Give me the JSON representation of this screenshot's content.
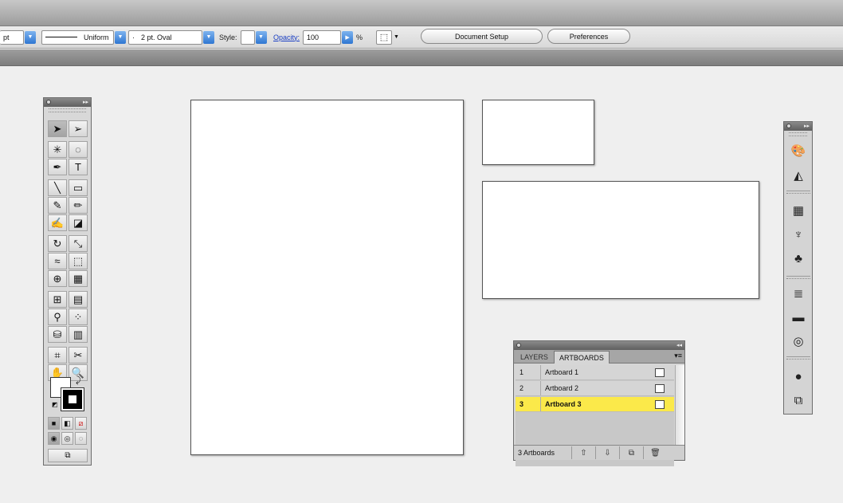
{
  "controlbar": {
    "units_value": "pt",
    "stroke_profile_label": "Uniform",
    "brush_value": "2 pt. Oval",
    "brush_prefix": "·",
    "style_label": "Style:",
    "opacity_label": "Opacity:",
    "opacity_value": "100",
    "percent_sign": "%",
    "document_setup_label": "Document Setup",
    "preferences_label": "Preferences"
  },
  "tools": [
    {
      "name": "selection-tool-icon",
      "glyph": "➤"
    },
    {
      "name": "direct-selection-tool-icon",
      "glyph": "➢"
    },
    {
      "name": "magic-wand-tool-icon",
      "glyph": "✳"
    },
    {
      "name": "lasso-tool-icon",
      "glyph": "◌"
    },
    {
      "name": "pen-tool-icon",
      "glyph": "✒"
    },
    {
      "name": "type-tool-icon",
      "glyph": "T"
    },
    {
      "name": "line-tool-icon",
      "glyph": "╲"
    },
    {
      "name": "rectangle-tool-icon",
      "glyph": "▭"
    },
    {
      "name": "paintbrush-tool-icon",
      "glyph": "✎"
    },
    {
      "name": "pencil-tool-icon",
      "glyph": "✏"
    },
    {
      "name": "blob-brush-tool-icon",
      "glyph": "✍"
    },
    {
      "name": "eraser-tool-icon",
      "glyph": "◪"
    },
    {
      "name": "rotate-tool-icon",
      "glyph": "↻"
    },
    {
      "name": "scale-tool-icon",
      "glyph": "⤡"
    },
    {
      "name": "warp-tool-icon",
      "glyph": "≈"
    },
    {
      "name": "free-transform-tool-icon",
      "glyph": "⬚"
    },
    {
      "name": "shape-builder-tool-icon",
      "glyph": "⊕"
    },
    {
      "name": "perspective-grid-tool-icon",
      "glyph": "▦"
    },
    {
      "name": "mesh-tool-icon",
      "glyph": "⊞"
    },
    {
      "name": "gradient-tool-icon",
      "glyph": "▤"
    },
    {
      "name": "eyedropper-tool-icon",
      "glyph": "⚲"
    },
    {
      "name": "blend-tool-icon",
      "glyph": "⁘"
    },
    {
      "name": "symbol-sprayer-tool-icon",
      "glyph": "⛁"
    },
    {
      "name": "column-graph-tool-icon",
      "glyph": "▥"
    },
    {
      "name": "artboard-tool-icon",
      "glyph": "⌗"
    },
    {
      "name": "slice-tool-icon",
      "glyph": "✂"
    },
    {
      "name": "hand-tool-icon",
      "glyph": "✋"
    },
    {
      "name": "zoom-tool-icon",
      "glyph": "🔍"
    }
  ],
  "dock": {
    "icons": [
      {
        "name": "color-panel-icon",
        "glyph": "🎨"
      },
      {
        "name": "color-guide-icon",
        "glyph": "◭"
      },
      {
        "name": "swatches-panel-icon",
        "glyph": "▦"
      },
      {
        "name": "brushes-panel-icon",
        "glyph": "♆"
      },
      {
        "name": "symbols-panel-icon",
        "glyph": "♣"
      },
      {
        "name": "stroke-panel-icon",
        "glyph": "≣"
      },
      {
        "name": "gradient-panel-icon",
        "glyph": "▬"
      },
      {
        "name": "transparency-panel-icon",
        "glyph": "◎"
      },
      {
        "name": "appearance-panel-icon",
        "glyph": "●"
      },
      {
        "name": "graphic-styles-panel-icon",
        "glyph": "⧉"
      }
    ]
  },
  "artboards_panel": {
    "tab_layers": "LAYERS",
    "tab_artboards": "ARTBOARDS",
    "menu_glyph": "▾≡",
    "rows": [
      {
        "num": "1",
        "name": "Artboard 1"
      },
      {
        "num": "2",
        "name": "Artboard 2"
      },
      {
        "num": "3",
        "name": "Artboard 3"
      }
    ],
    "selected_row": "3",
    "selected_color": "#fbe94a",
    "footer_count": "3 Artboards"
  }
}
